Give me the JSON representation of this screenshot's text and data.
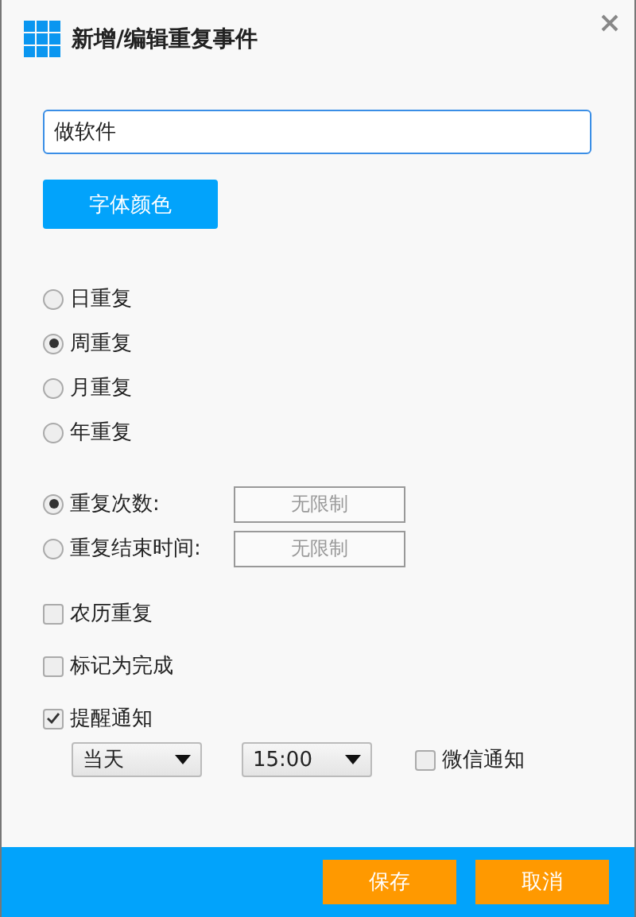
{
  "window": {
    "title": "新增/编辑重复事件"
  },
  "event_name": {
    "value": "做软件"
  },
  "font_color_button": {
    "label": "字体颜色"
  },
  "repeat_options": [
    {
      "label": "日重复",
      "selected": false
    },
    {
      "label": "周重复",
      "selected": true
    },
    {
      "label": "月重复",
      "selected": false
    },
    {
      "label": "年重复",
      "selected": false
    }
  ],
  "end_options": [
    {
      "label": "重复次数:",
      "selected": true,
      "placeholder": "无限制"
    },
    {
      "label": "重复结束时间:",
      "selected": false,
      "placeholder": "无限制"
    }
  ],
  "checkboxes": [
    {
      "label": "农历重复",
      "checked": false
    },
    {
      "label": "标记为完成",
      "checked": false
    },
    {
      "label": "提醒通知",
      "checked": true
    }
  ],
  "reminder": {
    "day": "当天",
    "time": "15:00",
    "wechat": {
      "label": "微信通知",
      "checked": false
    }
  },
  "buttons": [
    {
      "label": "保存"
    },
    {
      "label": "取消"
    }
  ]
}
